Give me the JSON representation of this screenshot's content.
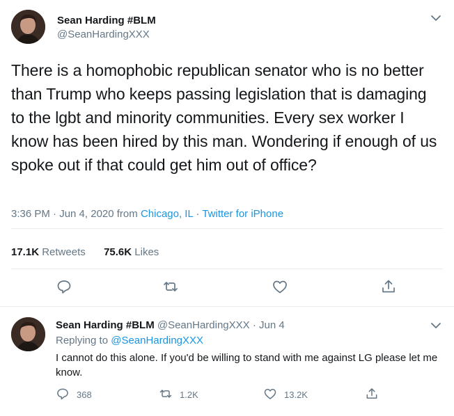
{
  "tweet": {
    "display_name": "Sean Harding #BLM",
    "handle": "@SeanHardingXXX",
    "text": "There is a homophobic republican senator who is no better than Trump who keeps passing legislation that is damaging to the lgbt and minority communities. Every sex worker I know has been hired by this man. Wondering if enough of us spoke out if that could get him out of office?",
    "time": "3:36 PM · Jun 4, 2020 from ",
    "location": "Chicago, IL",
    "dot": " · ",
    "source": "Twitter for iPhone",
    "retweets_count": "17.1K",
    "retweets_label": "Retweets",
    "likes_count": "75.6K",
    "likes_label": "Likes",
    "icons": [
      "reply-icon",
      "retweet-icon",
      "like-icon",
      "share-icon",
      "chevron-down-icon"
    ]
  },
  "reply": {
    "display_name": "Sean Harding #BLM",
    "handle_date": "@SeanHardingXXX · Jun 4",
    "replying_prefix": "Replying to ",
    "replying_to": "@SeanHardingXXX",
    "text": "I cannot do this alone. If you'd be willing to stand with me against LG please let me know.",
    "reply_count": "368",
    "retweet_count": "1.2K",
    "like_count": "13.2K"
  },
  "colors": {
    "link": "#1b95e0",
    "secondary_text": "#657786",
    "divider": "#e6ecf0"
  }
}
